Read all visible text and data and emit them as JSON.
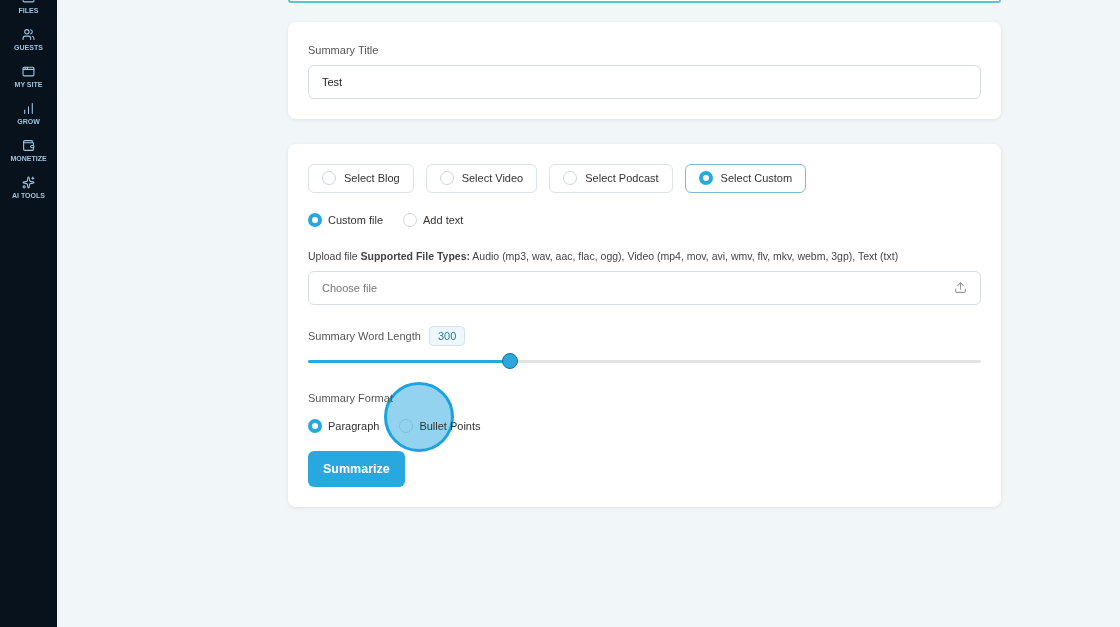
{
  "sidebar": {
    "items": [
      {
        "label": "FILES",
        "kind": "files"
      },
      {
        "label": "GUESTS",
        "kind": "guests"
      },
      {
        "label": "MY SITE",
        "kind": "site"
      },
      {
        "label": "GROW",
        "kind": "grow"
      },
      {
        "label": "MONETIZE",
        "kind": "monetize"
      },
      {
        "label": "AI TOOLS",
        "kind": "ai"
      }
    ]
  },
  "title_card": {
    "label": "Summary Title",
    "value": "Test"
  },
  "sources": [
    {
      "label": "Select Blog",
      "selected": false
    },
    {
      "label": "Select Video",
      "selected": false
    },
    {
      "label": "Select Podcast",
      "selected": false
    },
    {
      "label": "Select Custom",
      "selected": true
    }
  ],
  "input_modes": [
    {
      "label": "Custom file",
      "selected": true
    },
    {
      "label": "Add text",
      "selected": false
    }
  ],
  "upload": {
    "label": "Upload file **Supported File Types:** Audio (mp3, wav, aac, flac, ogg), Video (mp4, mov, avi, wmv, flv, mkv, webm, 3gp), Text (txt)",
    "placeholder": "Choose file"
  },
  "word_length": {
    "label": "Summary Word Length",
    "reading": "300",
    "level": 0.3
  },
  "format": {
    "label": "Summary Format",
    "options": [
      {
        "label": "Paragraph",
        "selected": true
      },
      {
        "label": "Bullet Points",
        "selected": false
      }
    ]
  },
  "submit": "Summarize"
}
